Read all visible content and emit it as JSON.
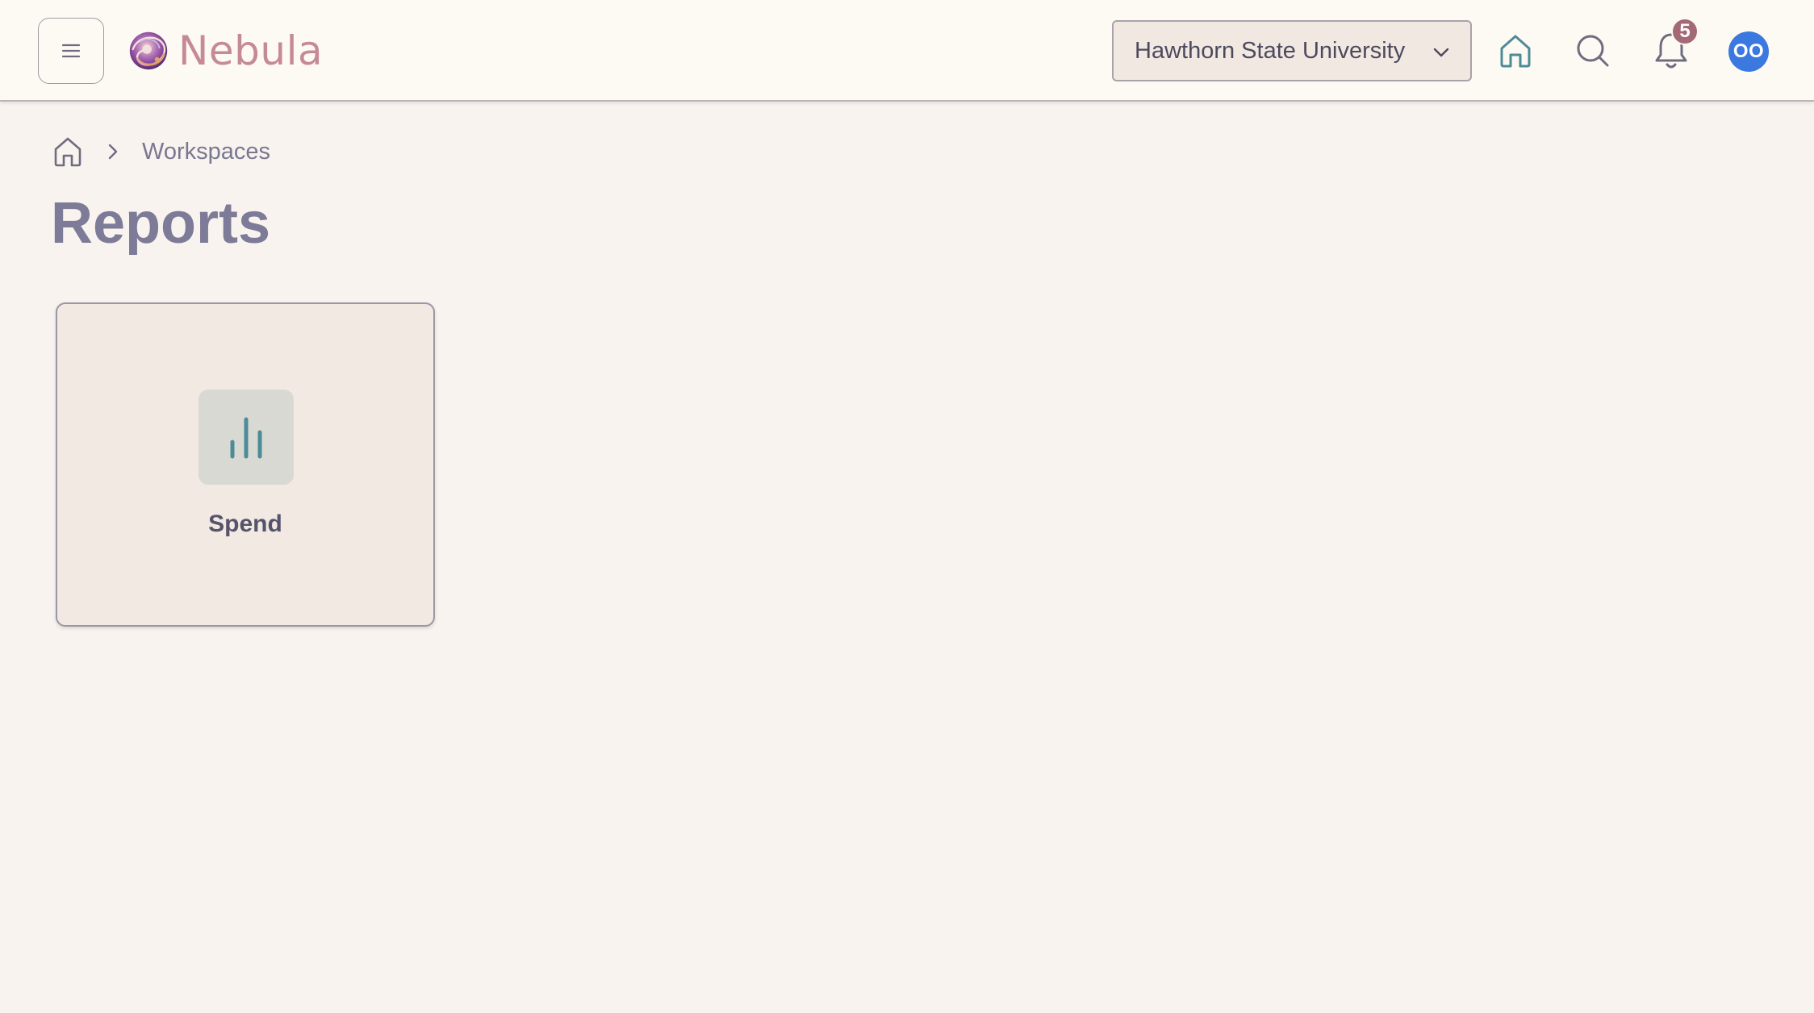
{
  "app": {
    "name": "Nebula"
  },
  "header": {
    "menu_icon": "hamburger-menu-icon",
    "logo_icon": "nebula-swirl-logo",
    "organization_selector": {
      "selected": "Hawthorn State University",
      "icon": "chevron-down-icon"
    },
    "home_icon": "home-icon",
    "search_icon": "search-icon",
    "notifications": {
      "icon": "bell-icon",
      "count": "5"
    },
    "avatar_initials": "OO"
  },
  "breadcrumb": {
    "home_icon": "home-icon",
    "separator_icon": "chevron-right-icon",
    "items": [
      {
        "label": "Workspaces"
      }
    ]
  },
  "page": {
    "title": "Reports"
  },
  "cards": [
    {
      "label": "Spend",
      "icon": "bar-chart-icon"
    }
  ],
  "colors": {
    "background": "#f8f3ee",
    "header_background": "#fdfaf4",
    "brand_text": "#c68a96",
    "accent_teal": "#4e8b98",
    "title_text": "#7e7b98",
    "badge": "#a36a76",
    "avatar": "#3b78e0",
    "card_background": "#f2e9e3",
    "card_icon_background": "#d9d9d3"
  }
}
